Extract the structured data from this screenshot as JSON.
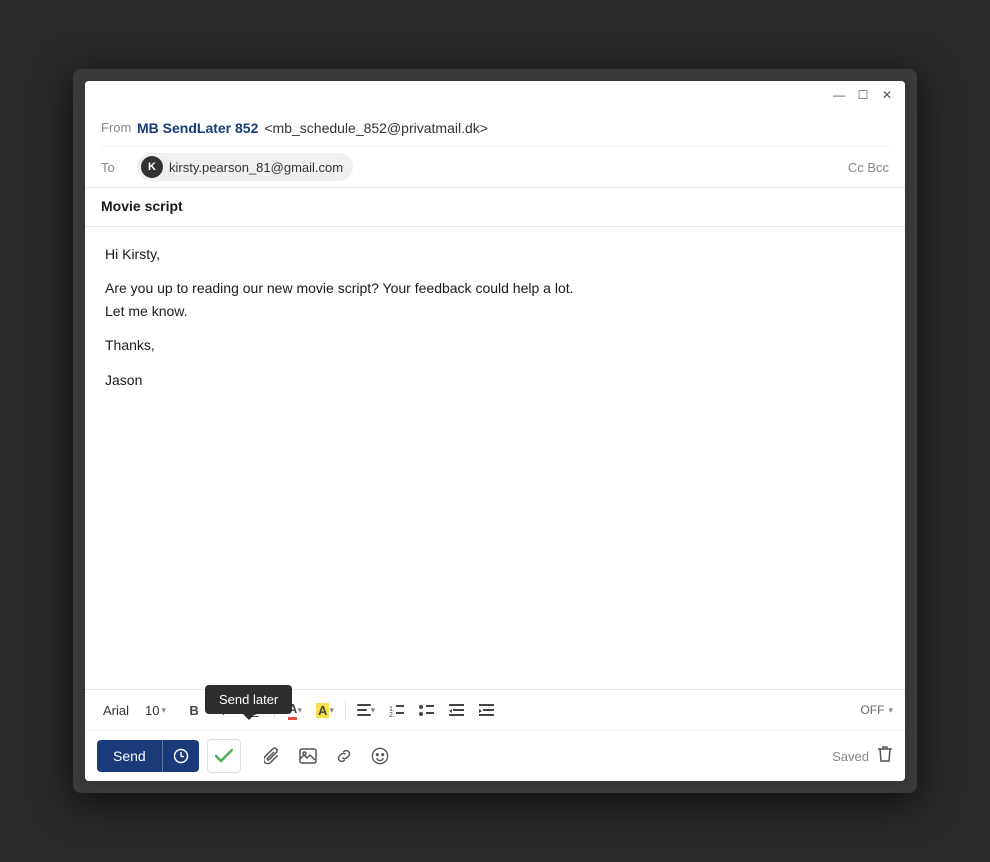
{
  "window": {
    "title_bar": {
      "minimize_label": "—",
      "maximize_label": "☐",
      "close_label": "✕"
    }
  },
  "header": {
    "from_label": "From",
    "from_name": "MB SendLater 852",
    "from_email": "<mb_schedule_852@privatmail.dk>",
    "to_label": "To",
    "recipient_initial": "K",
    "recipient_email": "kirsty.pearson_81@gmail.com",
    "cc_bcc": "Cc  Bcc"
  },
  "subject": {
    "text": "Movie script"
  },
  "body": {
    "line1": "Hi Kirsty,",
    "line2": "Are you up to reading our new movie script? Your feedback could help a lot.",
    "line3": "Let me know.",
    "line4": "Thanks,",
    "line5": "Jason"
  },
  "formatting": {
    "font_name": "Arial",
    "font_size": "10",
    "bold_label": "B",
    "italic_label": "I",
    "underline_label": "U",
    "off_label": "OFF"
  },
  "toolbar": {
    "send_label": "Send",
    "send_later_tooltip": "Send later",
    "saved_label": "Saved"
  }
}
